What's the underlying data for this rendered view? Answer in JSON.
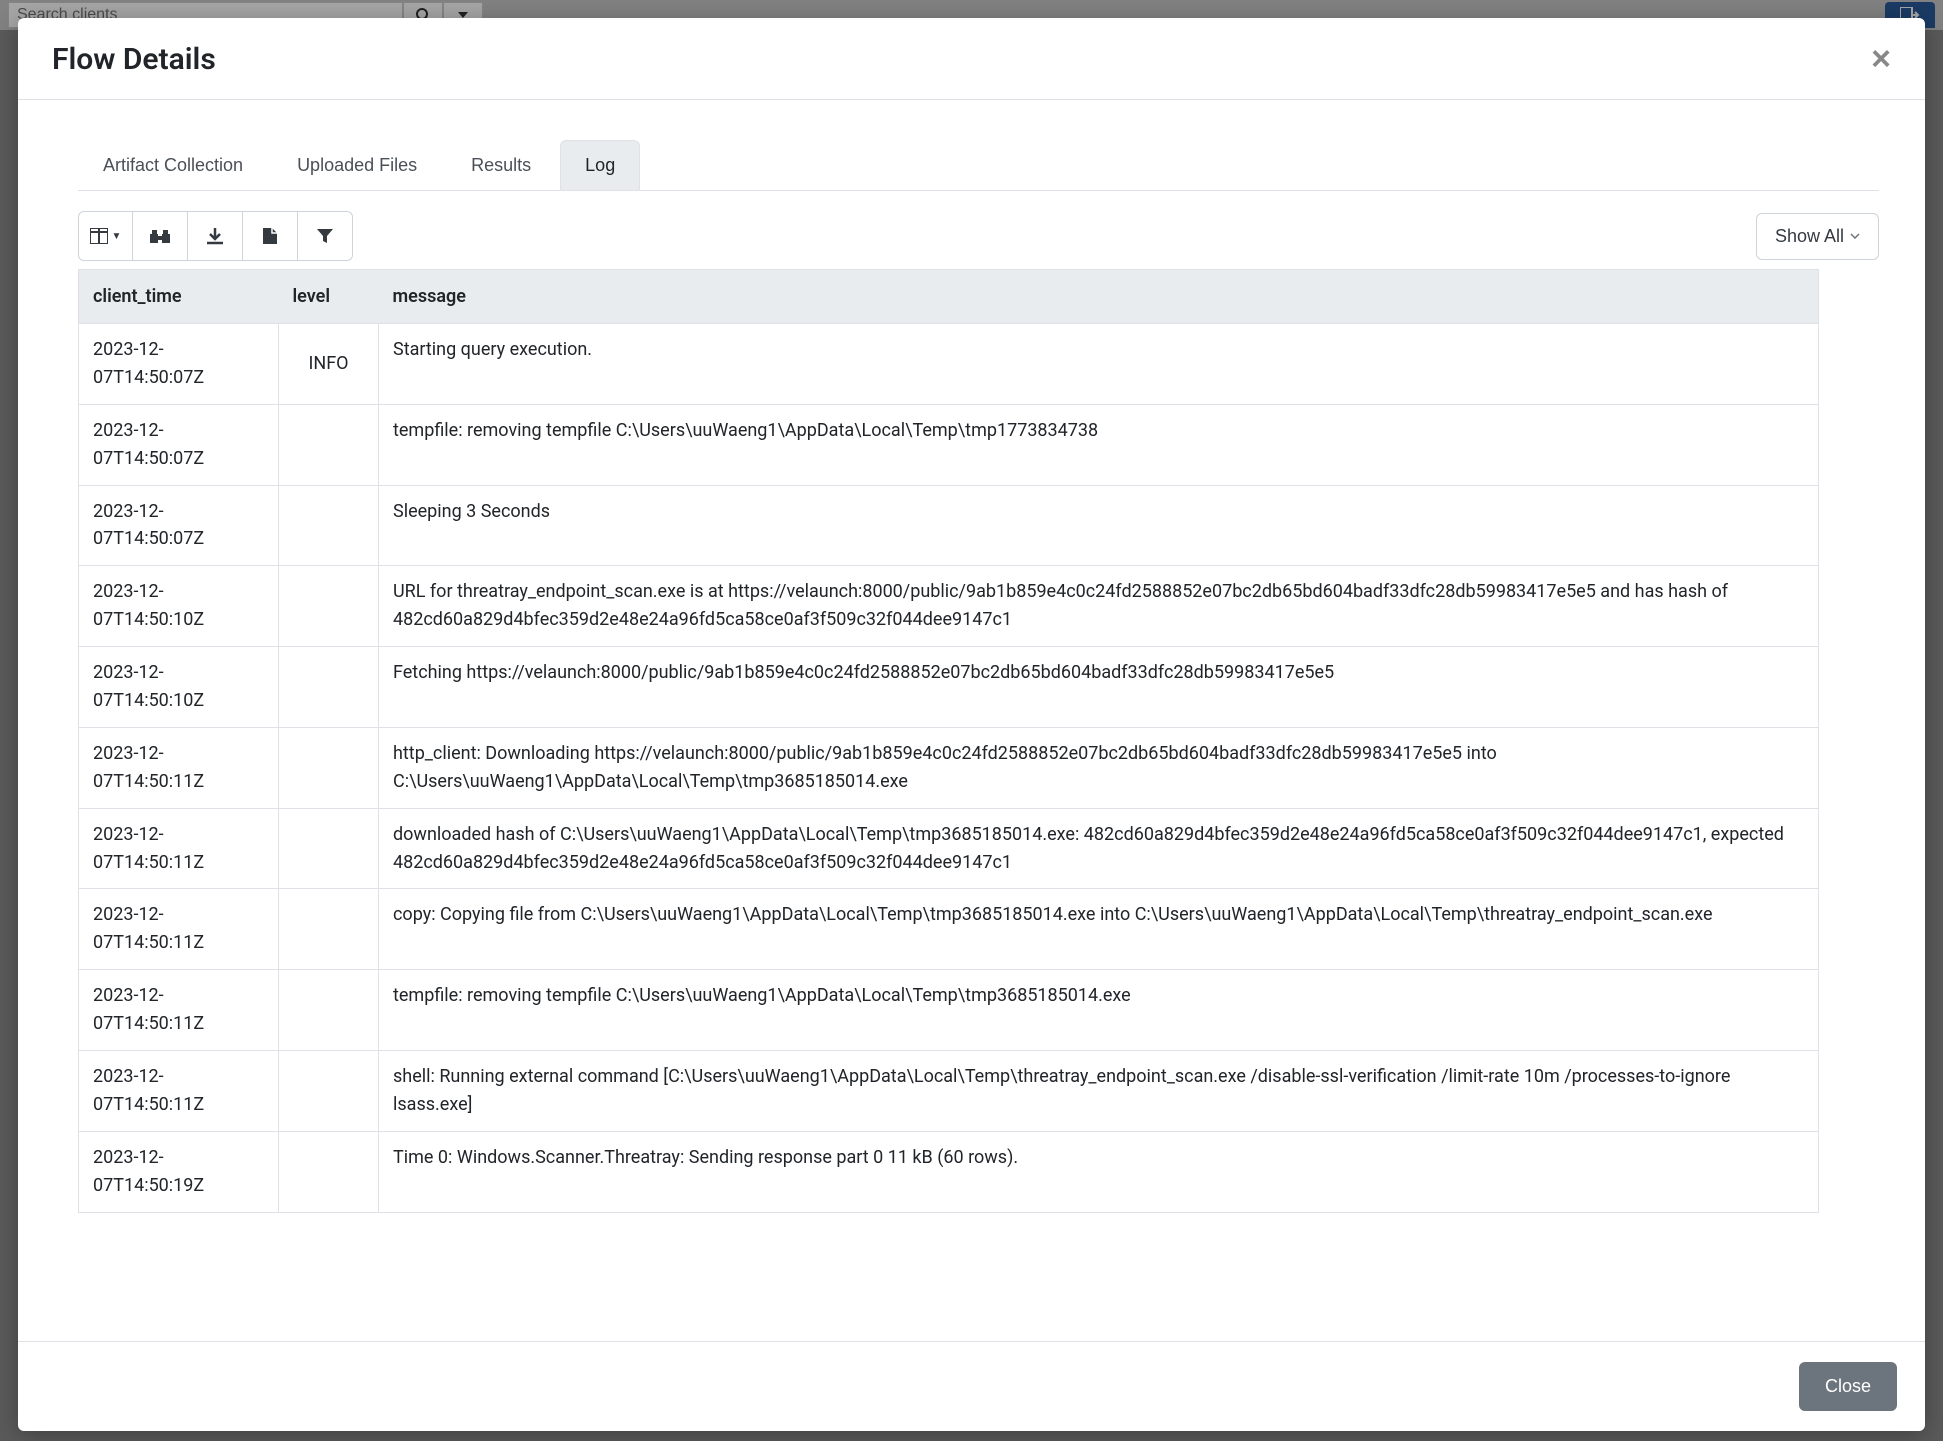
{
  "backdrop": {
    "search_placeholder": "Search clients"
  },
  "modal": {
    "title": "Flow Details",
    "close_button_label": "Close"
  },
  "tabs": [
    {
      "id": "artifact",
      "label": "Artifact Collection"
    },
    {
      "id": "uploaded",
      "label": "Uploaded Files"
    },
    {
      "id": "results",
      "label": "Results"
    },
    {
      "id": "log",
      "label": "Log"
    }
  ],
  "active_tab": "log",
  "filter_dropdown_label": "Show All",
  "log_columns": {
    "client_time": "client_time",
    "level": "level",
    "message": "message"
  },
  "log_rows": [
    {
      "client_time": "2023-12-07T14:50:07Z",
      "level": "INFO",
      "message": "Starting query execution."
    },
    {
      "client_time": "2023-12-07T14:50:07Z",
      "level": "",
      "message": "tempfile: removing tempfile C:\\Users\\uuWaeng1\\AppData\\Local\\Temp\\tmp1773834738"
    },
    {
      "client_time": "2023-12-07T14:50:07Z",
      "level": "",
      "message": "Sleeping 3 Seconds"
    },
    {
      "client_time": "2023-12-07T14:50:10Z",
      "level": "",
      "message": "URL for threatray_endpoint_scan.exe is at https://velaunch:8000/public/9ab1b859e4c0c24fd2588852e07bc2db65bd604badf33dfc28db59983417e5e5 and has hash of 482cd60a829d4bfec359d2e48e24a96fd5ca58ce0af3f509c32f044dee9147c1"
    },
    {
      "client_time": "2023-12-07T14:50:10Z",
      "level": "",
      "message": "Fetching https://velaunch:8000/public/9ab1b859e4c0c24fd2588852e07bc2db65bd604badf33dfc28db59983417e5e5"
    },
    {
      "client_time": "2023-12-07T14:50:11Z",
      "level": "",
      "message": "http_client: Downloading https://velaunch:8000/public/9ab1b859e4c0c24fd2588852e07bc2db65bd604badf33dfc28db59983417e5e5 into C:\\Users\\uuWaeng1\\AppData\\Local\\Temp\\tmp3685185014.exe"
    },
    {
      "client_time": "2023-12-07T14:50:11Z",
      "level": "",
      "message": "downloaded hash of C:\\Users\\uuWaeng1\\AppData\\Local\\Temp\\tmp3685185014.exe: 482cd60a829d4bfec359d2e48e24a96fd5ca58ce0af3f509c32f044dee9147c1, expected 482cd60a829d4bfec359d2e48e24a96fd5ca58ce0af3f509c32f044dee9147c1"
    },
    {
      "client_time": "2023-12-07T14:50:11Z",
      "level": "",
      "message": "copy: Copying file from C:\\Users\\uuWaeng1\\AppData\\Local\\Temp\\tmp3685185014.exe into C:\\Users\\uuWaeng1\\AppData\\Local\\Temp\\threatray_endpoint_scan.exe"
    },
    {
      "client_time": "2023-12-07T14:50:11Z",
      "level": "",
      "message": "tempfile: removing tempfile C:\\Users\\uuWaeng1\\AppData\\Local\\Temp\\tmp3685185014.exe"
    },
    {
      "client_time": "2023-12-07T14:50:11Z",
      "level": "",
      "message": "shell: Running external command [C:\\Users\\uuWaeng1\\AppData\\Local\\Temp\\threatray_endpoint_scan.exe /disable-ssl-verification /limit-rate 10m /processes-to-ignore lsass.exe]"
    },
    {
      "client_time": "2023-12-07T14:50:19Z",
      "level": "",
      "message": "Time 0: Windows.Scanner.Threatray: Sending response part 0 11 kB (60 rows)."
    }
  ]
}
